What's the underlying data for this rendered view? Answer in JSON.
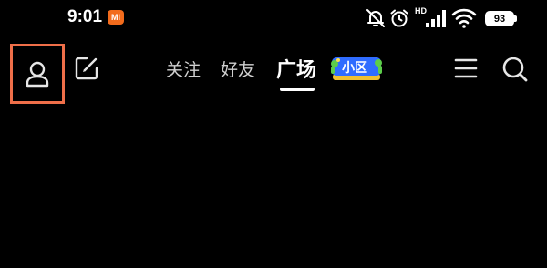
{
  "status_bar": {
    "time": "9:01",
    "carrier_badge": "MI",
    "battery": "93",
    "icons": [
      "mute-bell-icon",
      "alarm-icon",
      "hd-signal-icon",
      "wifi-icon",
      "battery-icon"
    ]
  },
  "nav": {
    "tabs": [
      {
        "label": "关注",
        "active": false
      },
      {
        "label": "好友",
        "active": false
      },
      {
        "label": "广场",
        "active": true
      }
    ],
    "badge_label": "小区",
    "icons": [
      "profile-icon",
      "edit-icon",
      "menu-icon",
      "search-icon"
    ],
    "highlight_color": "#ef6f49",
    "badge_color": "#2f6cff"
  }
}
